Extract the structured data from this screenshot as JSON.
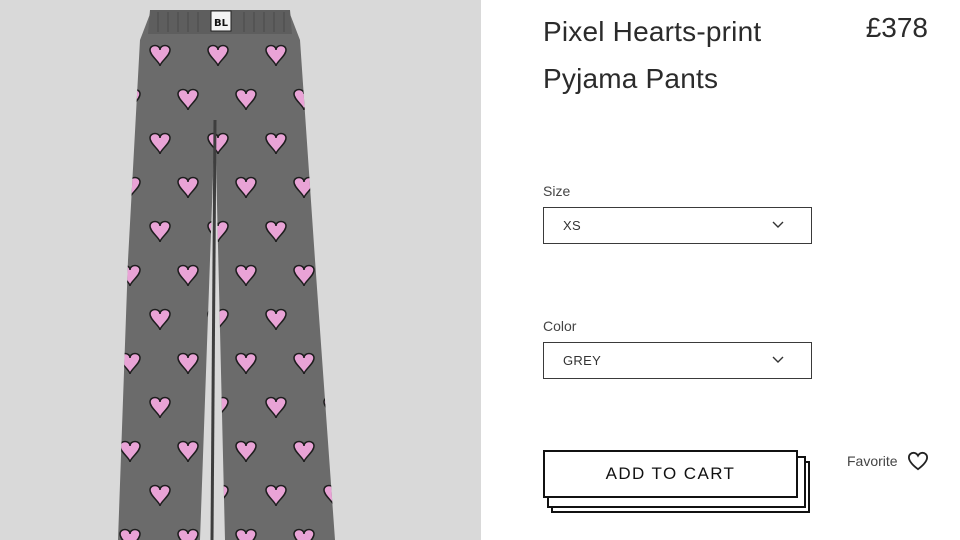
{
  "product": {
    "title_line1": "Pixel Hearts-print",
    "title_line2": "Pyjama Pants",
    "price": "£378",
    "image_label": "BL"
  },
  "size": {
    "label": "Size",
    "value": "XS"
  },
  "color": {
    "label": "Color",
    "value": "GREY"
  },
  "actions": {
    "add_to_cart": "ADD TO CART",
    "favorite": "Favorite"
  },
  "icons": [
    "chevron-down-icon",
    "heart-icon"
  ],
  "colors": {
    "image_background": "#d9d9d9",
    "fabric": "#6b6b6b",
    "heart_pink": "#e9a3d6"
  }
}
